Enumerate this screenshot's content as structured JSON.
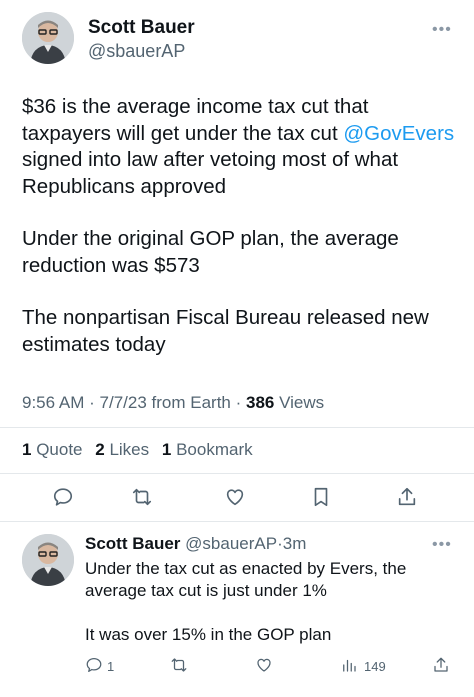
{
  "main_tweet": {
    "author_name": "Scott Bauer",
    "author_handle": "@sbauerAP",
    "more_icon": "more-horizontal-icon",
    "body": {
      "p1_before": "$36 is the average income tax cut that taxpayers will get under the tax cut ",
      "p1_mention": "@GovEvers",
      "p1_after": " signed into law after vetoing most of what Republicans approved",
      "p2": "Under the original GOP plan, the average reduction was $573",
      "p3": "The nonpartisan Fiscal Bureau released new estimates today"
    },
    "meta": {
      "time": "9:56 AM",
      "date": "7/7/23",
      "source": "from Earth",
      "views_count": "386",
      "views_label": "Views",
      "sep": "·"
    },
    "stats": {
      "quotes_count": "1",
      "quotes_label": "Quote",
      "likes_count": "2",
      "likes_label": "Likes",
      "bookmarks_count": "1",
      "bookmarks_label": "Bookmark"
    },
    "actions": [
      "reply-icon",
      "retweet-icon",
      "like-icon",
      "bookmark-icon",
      "share-icon"
    ]
  },
  "reply_tweet": {
    "author_name": "Scott Bauer",
    "author_handle": "@sbauerAP",
    "sep": "·",
    "time_ago": "3m",
    "body_p1": "Under the tax cut as enacted by Evers, the average tax cut is just under 1%",
    "body_p2": "It was over 15% in the GOP plan",
    "reply_count": "1",
    "views_count": "149",
    "actions": [
      "reply-icon",
      "retweet-icon",
      "like-icon",
      "views-icon",
      "share-icon"
    ]
  },
  "colors": {
    "accent": "#1d9bf0",
    "text_primary": "#0f1419",
    "text_secondary": "#536471",
    "divider": "#e4e8eb"
  }
}
